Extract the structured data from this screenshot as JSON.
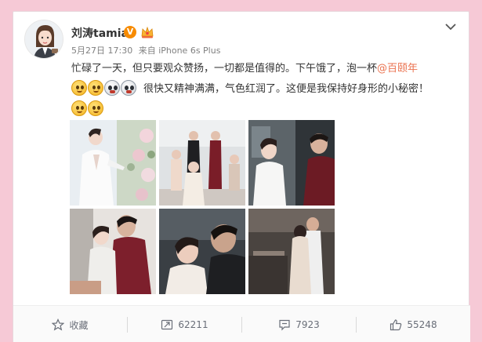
{
  "post": {
    "username": "刘涛tamia",
    "verified_badge": "V",
    "date": "5月27日 17:30",
    "source": "来自 iPhone 6s Plus",
    "text_part1": "忙碌了一天，但只要观众赞扬，一切都是值得的。下午饿了，泡一杯",
    "mention": "@百颐年",
    "text_part2": "很快又精神满满，气色红润了。这便是我保持好身形的小秘密！",
    "emojis_line1": [
      "blush-emoji",
      "blush-emoji",
      "shocked-emoji",
      "shocked-emoji"
    ],
    "emojis_line2": [
      "blush-emoji",
      "blush-emoji"
    ],
    "photos": [
      "woman-in-white-suit-with-flowers",
      "group-standing-on-stage",
      "woman-and-man-in-suit",
      "couple-embracing",
      "woman-and-man-closeup",
      "couple-in-kitchen"
    ]
  },
  "actions": {
    "favorite_label": "收藏",
    "repost_count": "62211",
    "comment_count": "7923",
    "like_count": "55248"
  },
  "colors": {
    "background": "#f6c9d6",
    "mention": "#eb7350",
    "text": "#333333",
    "meta": "#808080"
  }
}
